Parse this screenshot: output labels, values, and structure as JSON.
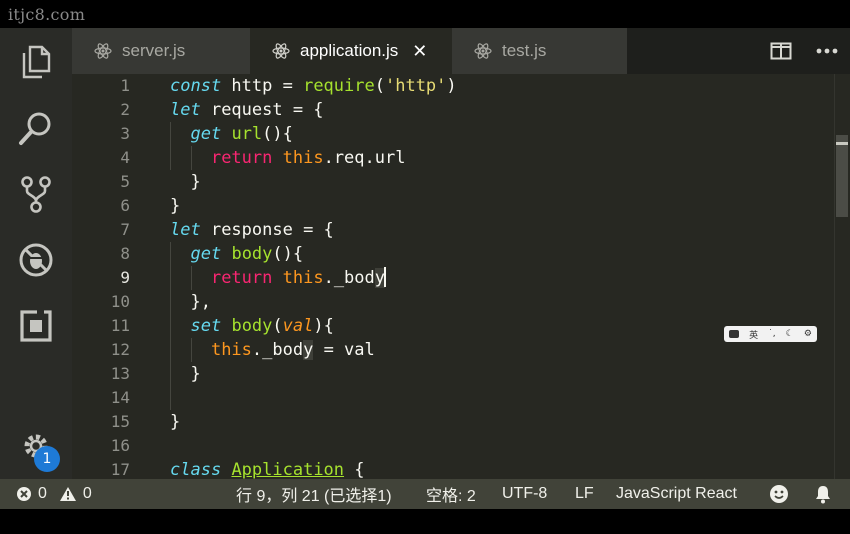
{
  "watermark": "itjc8.com",
  "tabs": [
    {
      "label": "server.js",
      "active": false
    },
    {
      "label": "application.js",
      "active": true,
      "close": "✕"
    },
    {
      "label": "test.js",
      "active": false
    }
  ],
  "activity": {
    "badge": "1"
  },
  "ime": {
    "label": "英"
  },
  "code": {
    "line_numbers": [
      "1",
      "2",
      "3",
      "4",
      "5",
      "6",
      "7",
      "8",
      "9",
      "10",
      "11",
      "12",
      "13",
      "14",
      "15",
      "16",
      "17"
    ],
    "current_line": "9"
  },
  "status": {
    "errors": "0",
    "warnings": "0",
    "position": "行 9，列 21 (已选择1)",
    "indent": "空格: 2",
    "encoding": "UTF-8",
    "eol": "LF",
    "language": "JavaScript React"
  },
  "colors": {
    "editor_bg": "#272822",
    "keyword": "#66d9ef",
    "control": "#f92672",
    "function": "#a6e22e",
    "string": "#e6db74",
    "this": "#fd971f",
    "status_bg": "#414339",
    "badge": "#1e7ad6"
  }
}
